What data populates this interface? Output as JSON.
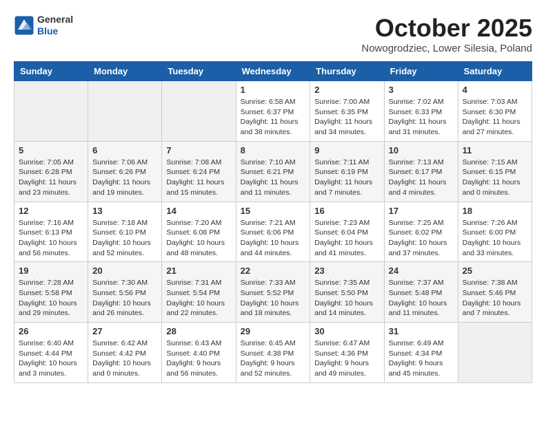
{
  "header": {
    "logo_general": "General",
    "logo_blue": "Blue",
    "month_title": "October 2025",
    "location": "Nowogrodziec, Lower Silesia, Poland"
  },
  "days_of_week": [
    "Sunday",
    "Monday",
    "Tuesday",
    "Wednesday",
    "Thursday",
    "Friday",
    "Saturday"
  ],
  "weeks": [
    [
      {
        "day": "",
        "content": ""
      },
      {
        "day": "",
        "content": ""
      },
      {
        "day": "",
        "content": ""
      },
      {
        "day": "1",
        "content": "Sunrise: 6:58 AM\nSunset: 6:37 PM\nDaylight: 11 hours\nand 38 minutes."
      },
      {
        "day": "2",
        "content": "Sunrise: 7:00 AM\nSunset: 6:35 PM\nDaylight: 11 hours\nand 34 minutes."
      },
      {
        "day": "3",
        "content": "Sunrise: 7:02 AM\nSunset: 6:33 PM\nDaylight: 11 hours\nand 31 minutes."
      },
      {
        "day": "4",
        "content": "Sunrise: 7:03 AM\nSunset: 6:30 PM\nDaylight: 11 hours\nand 27 minutes."
      }
    ],
    [
      {
        "day": "5",
        "content": "Sunrise: 7:05 AM\nSunset: 6:28 PM\nDaylight: 11 hours\nand 23 minutes."
      },
      {
        "day": "6",
        "content": "Sunrise: 7:06 AM\nSunset: 6:26 PM\nDaylight: 11 hours\nand 19 minutes."
      },
      {
        "day": "7",
        "content": "Sunrise: 7:08 AM\nSunset: 6:24 PM\nDaylight: 11 hours\nand 15 minutes."
      },
      {
        "day": "8",
        "content": "Sunrise: 7:10 AM\nSunset: 6:21 PM\nDaylight: 11 hours\nand 11 minutes."
      },
      {
        "day": "9",
        "content": "Sunrise: 7:11 AM\nSunset: 6:19 PM\nDaylight: 11 hours\nand 7 minutes."
      },
      {
        "day": "10",
        "content": "Sunrise: 7:13 AM\nSunset: 6:17 PM\nDaylight: 11 hours\nand 4 minutes."
      },
      {
        "day": "11",
        "content": "Sunrise: 7:15 AM\nSunset: 6:15 PM\nDaylight: 11 hours\nand 0 minutes."
      }
    ],
    [
      {
        "day": "12",
        "content": "Sunrise: 7:16 AM\nSunset: 6:13 PM\nDaylight: 10 hours\nand 56 minutes."
      },
      {
        "day": "13",
        "content": "Sunrise: 7:18 AM\nSunset: 6:10 PM\nDaylight: 10 hours\nand 52 minutes."
      },
      {
        "day": "14",
        "content": "Sunrise: 7:20 AM\nSunset: 6:08 PM\nDaylight: 10 hours\nand 48 minutes."
      },
      {
        "day": "15",
        "content": "Sunrise: 7:21 AM\nSunset: 6:06 PM\nDaylight: 10 hours\nand 44 minutes."
      },
      {
        "day": "16",
        "content": "Sunrise: 7:23 AM\nSunset: 6:04 PM\nDaylight: 10 hours\nand 41 minutes."
      },
      {
        "day": "17",
        "content": "Sunrise: 7:25 AM\nSunset: 6:02 PM\nDaylight: 10 hours\nand 37 minutes."
      },
      {
        "day": "18",
        "content": "Sunrise: 7:26 AM\nSunset: 6:00 PM\nDaylight: 10 hours\nand 33 minutes."
      }
    ],
    [
      {
        "day": "19",
        "content": "Sunrise: 7:28 AM\nSunset: 5:58 PM\nDaylight: 10 hours\nand 29 minutes."
      },
      {
        "day": "20",
        "content": "Sunrise: 7:30 AM\nSunset: 5:56 PM\nDaylight: 10 hours\nand 26 minutes."
      },
      {
        "day": "21",
        "content": "Sunrise: 7:31 AM\nSunset: 5:54 PM\nDaylight: 10 hours\nand 22 minutes."
      },
      {
        "day": "22",
        "content": "Sunrise: 7:33 AM\nSunset: 5:52 PM\nDaylight: 10 hours\nand 18 minutes."
      },
      {
        "day": "23",
        "content": "Sunrise: 7:35 AM\nSunset: 5:50 PM\nDaylight: 10 hours\nand 14 minutes."
      },
      {
        "day": "24",
        "content": "Sunrise: 7:37 AM\nSunset: 5:48 PM\nDaylight: 10 hours\nand 11 minutes."
      },
      {
        "day": "25",
        "content": "Sunrise: 7:38 AM\nSunset: 5:46 PM\nDaylight: 10 hours\nand 7 minutes."
      }
    ],
    [
      {
        "day": "26",
        "content": "Sunrise: 6:40 AM\nSunset: 4:44 PM\nDaylight: 10 hours\nand 3 minutes."
      },
      {
        "day": "27",
        "content": "Sunrise: 6:42 AM\nSunset: 4:42 PM\nDaylight: 10 hours\nand 0 minutes."
      },
      {
        "day": "28",
        "content": "Sunrise: 6:43 AM\nSunset: 4:40 PM\nDaylight: 9 hours\nand 56 minutes."
      },
      {
        "day": "29",
        "content": "Sunrise: 6:45 AM\nSunset: 4:38 PM\nDaylight: 9 hours\nand 52 minutes."
      },
      {
        "day": "30",
        "content": "Sunrise: 6:47 AM\nSunset: 4:36 PM\nDaylight: 9 hours\nand 49 minutes."
      },
      {
        "day": "31",
        "content": "Sunrise: 6:49 AM\nSunset: 4:34 PM\nDaylight: 9 hours\nand 45 minutes."
      },
      {
        "day": "",
        "content": ""
      }
    ]
  ]
}
